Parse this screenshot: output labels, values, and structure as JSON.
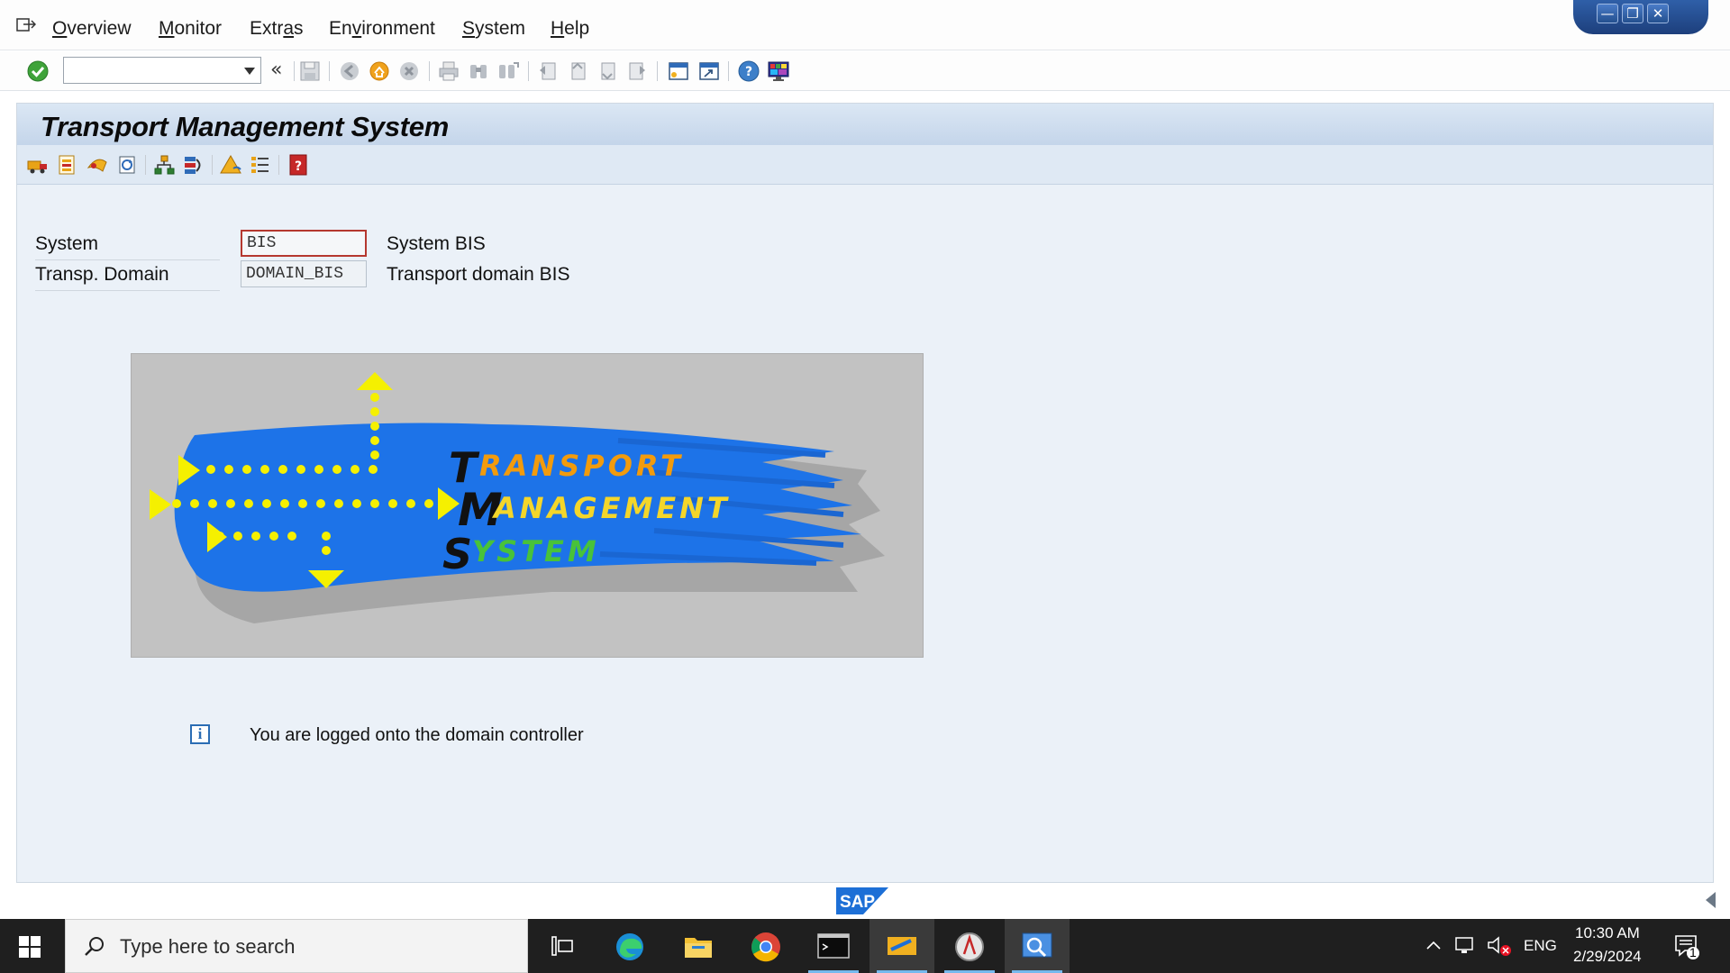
{
  "menubar": {
    "items": [
      {
        "pre": "",
        "ul": "O",
        "post": "verview"
      },
      {
        "pre": "",
        "ul": "M",
        "post": "onitor"
      },
      {
        "pre": "Extr",
        "ul": "a",
        "post": "s"
      },
      {
        "pre": "En",
        "ul": "v",
        "post": "ironment"
      },
      {
        "pre": "",
        "ul": "S",
        "post": "ystem"
      },
      {
        "pre": "",
        "ul": "H",
        "post": "elp"
      }
    ],
    "window_controls": {
      "minimize": "—",
      "restore": "❐",
      "close": "✕"
    }
  },
  "toolbar": {
    "command_value": "",
    "back_glyph": "«"
  },
  "screen": {
    "title": "Transport Management System"
  },
  "fields": {
    "system": {
      "label": "System",
      "value": "BIS",
      "description": "System BIS"
    },
    "domain": {
      "label": "Transp. Domain",
      "value": "DOMAIN_BIS",
      "description": "Transport domain BIS"
    }
  },
  "logo": {
    "line1_initial": "T",
    "line1_rest": "RANSPORT",
    "line2_initial": "M",
    "line2_rest": "ANAGEMENT",
    "line3_initial": "S",
    "line3_rest": "YSTEM"
  },
  "message": {
    "icon": "info-icon",
    "icon_glyph": "i",
    "text": "You are logged onto the domain controller"
  },
  "footer": {
    "sap_logo": "SAP"
  },
  "taskbar": {
    "search_placeholder": "Type here to search",
    "language": "ENG",
    "time": "10:30 AM",
    "date": "2/29/2024",
    "notification_count": "1"
  },
  "colors": {
    "title_gradient_top": "#dbe7f4",
    "panel_bg": "#ebf1f8",
    "logo_brush": "#1d73e8",
    "logo_dots": "#f5f000",
    "taskbar": "#1f1f1f"
  }
}
